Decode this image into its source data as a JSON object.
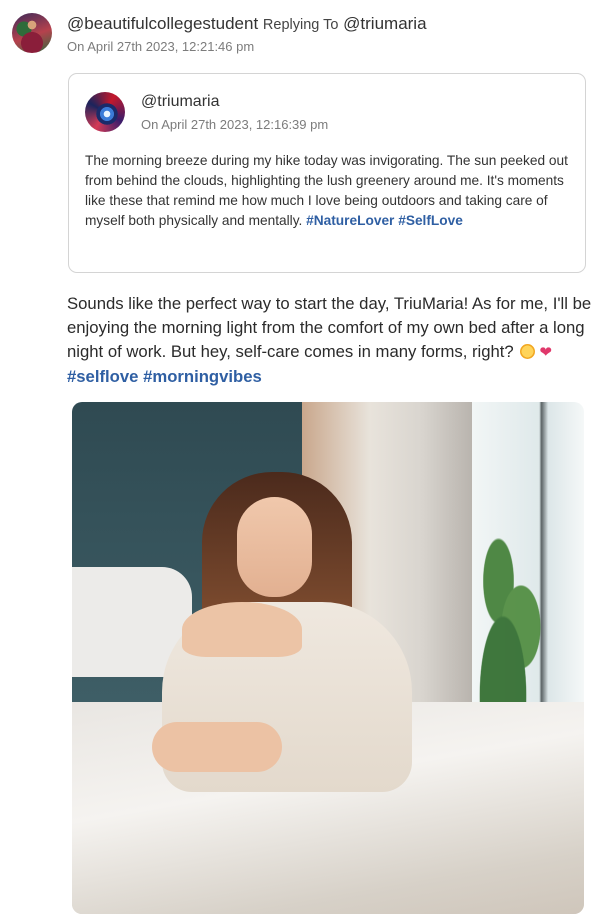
{
  "reply": {
    "author": "@beautifulcollegestudent",
    "replying_label": "Replying To",
    "replying_to": "@triumaria",
    "timestamp": "On April 27th 2023, 12:21:46 pm",
    "text": "Sounds like the perfect way to start the day, TriuMaria! As for me, I'll be enjoying the morning light from the comfort of my own bed after a long night of work. But hey, self-care comes in many forms, right?",
    "emojis": [
      "sun-emoji",
      "heart-emoji"
    ],
    "hashtags": [
      "#selflove",
      "#morningvibes"
    ]
  },
  "quoted_post": {
    "author": "@triumaria",
    "timestamp": "On April 27th 2023, 12:16:39 pm",
    "text": "The morning breeze during my hike today was invigorating. The sun peeked out from behind the clouds, highlighting the lush greenery around me. It's moments like these that remind me how much I love being outdoors and taking care of myself both physically and mentally.",
    "hashtags": [
      "#NatureLover",
      "#SelfLove"
    ]
  },
  "colors": {
    "hashtag": "#2f5fa3",
    "card_border": "#d4d4d4",
    "timestamp": "#7c7c7c"
  }
}
